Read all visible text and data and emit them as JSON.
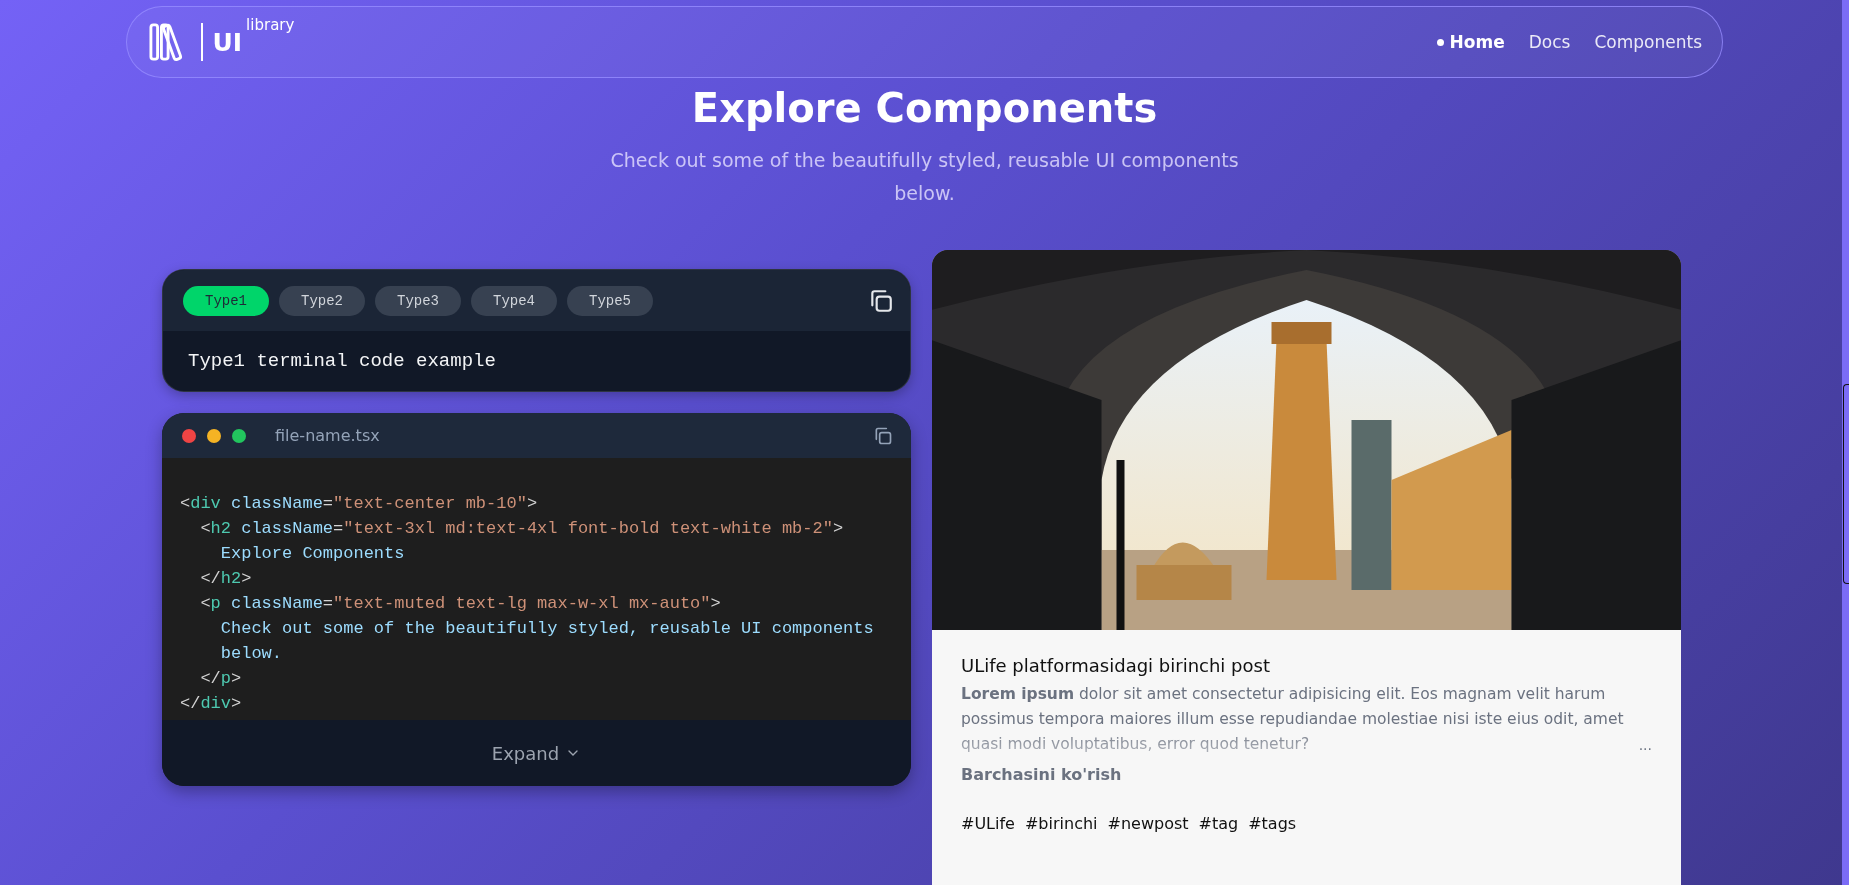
{
  "navbar": {
    "logo": {
      "text": "UI",
      "superscript": "library"
    },
    "items": [
      {
        "label": "Home",
        "selected": true
      },
      {
        "label": "Docs",
        "selected": false
      },
      {
        "label": "Components",
        "selected": false
      }
    ]
  },
  "hero": {
    "title": "Explore Components",
    "subtitle": "Check out some of the beautifully styled, reusable UI components below."
  },
  "terminal": {
    "tabs": [
      {
        "label": "Type1",
        "selected": true
      },
      {
        "label": "Type2",
        "selected": false
      },
      {
        "label": "Type3",
        "selected": false
      },
      {
        "label": "Type4",
        "selected": false
      },
      {
        "label": "Type5",
        "selected": false
      }
    ],
    "output": "Type1 terminal code example"
  },
  "code_window": {
    "filename": "file-name.tsx",
    "lines": [
      [
        {
          "kind": "punct",
          "text": "<"
        },
        {
          "kind": "tag",
          "text": "div"
        },
        {
          "kind": "attr",
          "text": " className"
        },
        {
          "kind": "punct",
          "text": "="
        },
        {
          "kind": "string",
          "text": "\"text-center mb-10\""
        },
        {
          "kind": "punct",
          "text": ">"
        }
      ],
      [
        {
          "kind": "punct",
          "text": "  <"
        },
        {
          "kind": "tag",
          "text": "h2"
        },
        {
          "kind": "attr",
          "text": " className"
        },
        {
          "kind": "punct",
          "text": "="
        },
        {
          "kind": "string",
          "text": "\"text-3xl md:text-4xl font-bold text-white mb-2\""
        },
        {
          "kind": "punct",
          "text": ">"
        }
      ],
      [
        {
          "kind": "text",
          "text": "    Explore Components"
        }
      ],
      [
        {
          "kind": "punct",
          "text": "  </"
        },
        {
          "kind": "tag",
          "text": "h2"
        },
        {
          "kind": "punct",
          "text": ">"
        }
      ],
      [
        {
          "kind": "punct",
          "text": "  <"
        },
        {
          "kind": "tag",
          "text": "p"
        },
        {
          "kind": "attr",
          "text": " className"
        },
        {
          "kind": "punct",
          "text": "="
        },
        {
          "kind": "string",
          "text": "\"text-muted text-lg max-w-xl mx-auto\""
        },
        {
          "kind": "punct",
          "text": ">"
        }
      ],
      [
        {
          "kind": "text",
          "text": "    Check out some of the beautifully styled, reusable UI components"
        }
      ],
      [
        {
          "kind": "text",
          "text": "    below."
        }
      ],
      [
        {
          "kind": "punct",
          "text": "  </"
        },
        {
          "kind": "tag",
          "text": "p"
        },
        {
          "kind": "punct",
          "text": ">"
        }
      ],
      [
        {
          "kind": "punct",
          "text": "</"
        },
        {
          "kind": "tag",
          "text": "div"
        },
        {
          "kind": "punct",
          "text": ">"
        }
      ]
    ],
    "expand_label": "Expand"
  },
  "post": {
    "image": {
      "kind": "picture"
    },
    "title": "ULife platformasidagi birinchi post",
    "excerpt": "**Lorem ipsum** dolor sit amet consectetur adipisicing elit. Eos magnam velit harum possimus tempora maiores illum esse repudiandae molestiae nisi iste eius odit, amet quasi modi voluptatibus, error quod tenetur?",
    "more": "...",
    "read_more": "Barchasini ko'rish",
    "tags": [
      "#ULife",
      "#birinchi",
      "#newpost",
      "#tag",
      "#tags"
    ]
  }
}
